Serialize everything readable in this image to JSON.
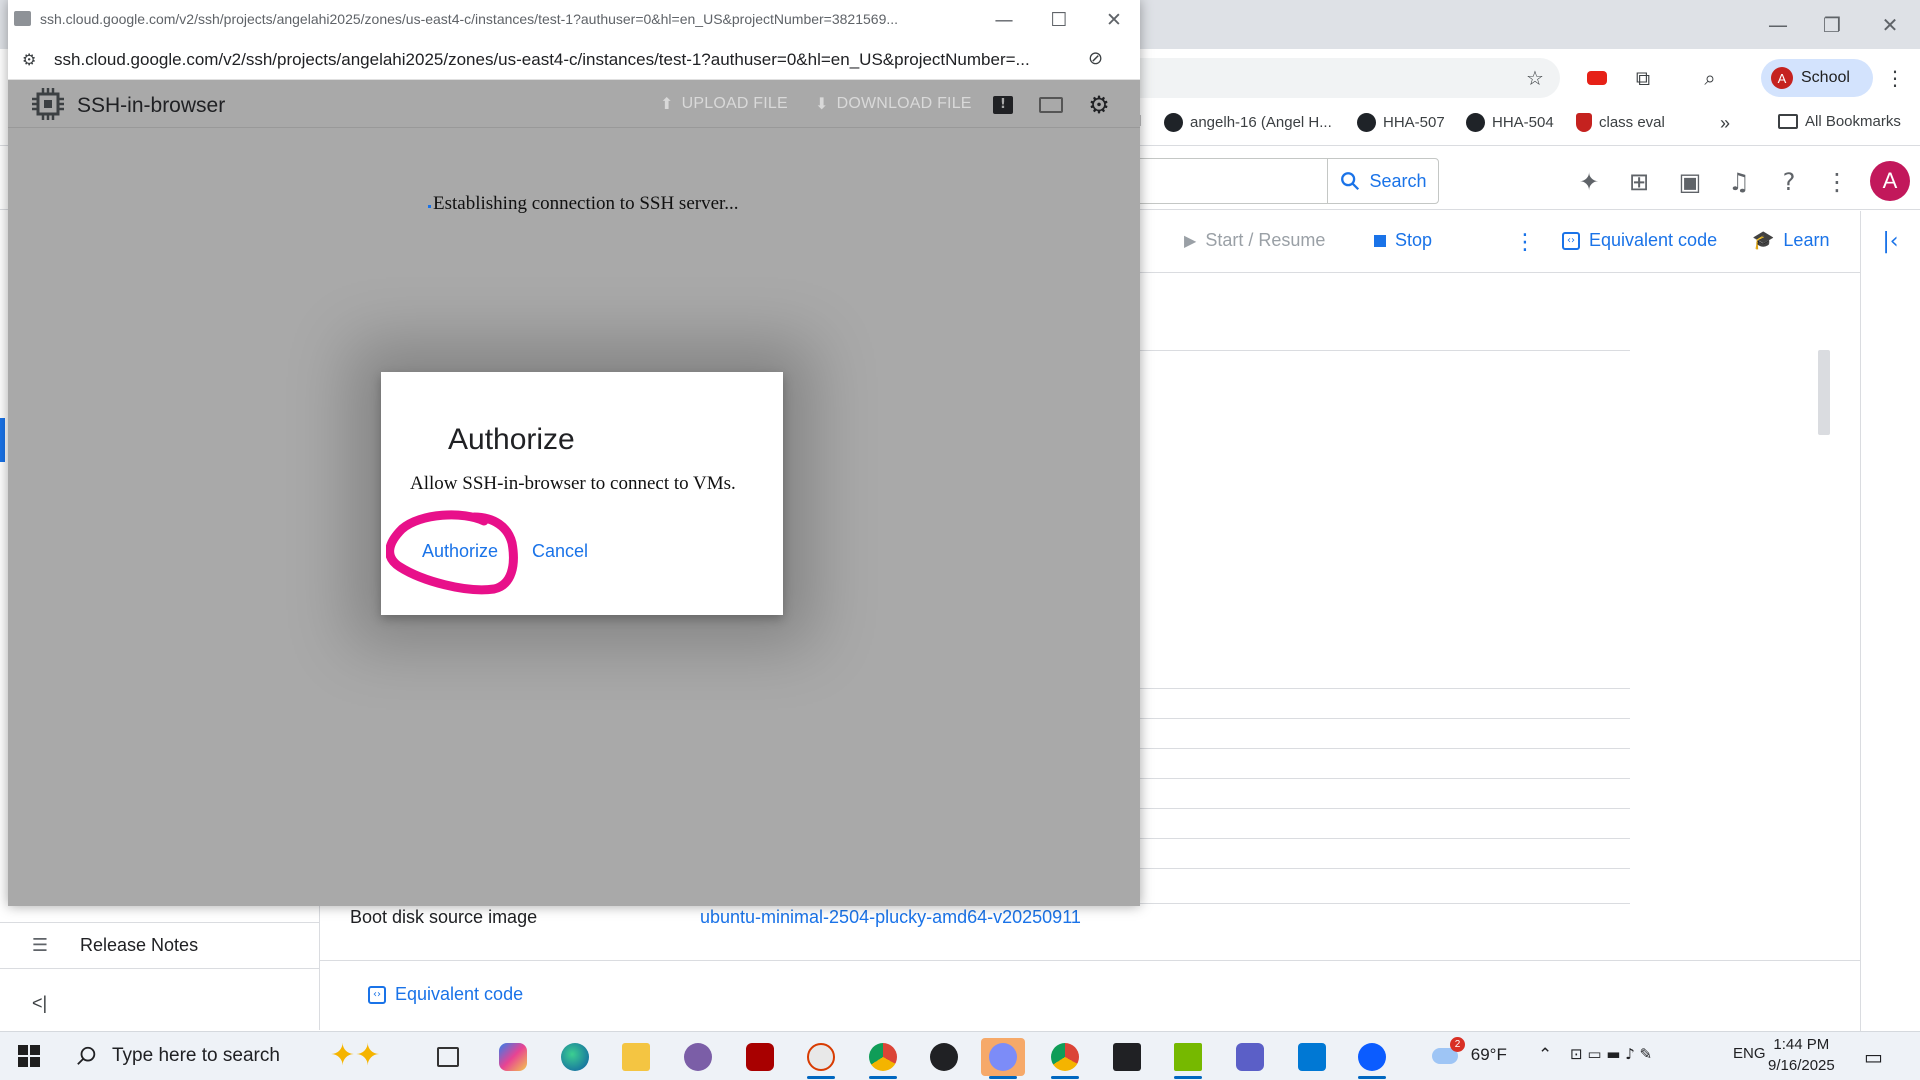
{
  "background": {
    "bookmarks": [
      "l",
      "angelh-16 (Angel H...",
      "HHA-507",
      "HHA-504",
      "class eval",
      "»",
      "All Bookmarks"
    ],
    "profile_chip": "School",
    "profile_initial": "A",
    "search_label": "Search",
    "avatar_initial": "A",
    "actions": {
      "start_resume": "Start / Resume",
      "stop": "Stop",
      "equivalent_code": "Equivalent code",
      "learn": "Learn"
    },
    "left_nav": {
      "release_notes": "Release Notes",
      "collapse": "<|"
    },
    "boot_disk_label": "Boot disk source image",
    "boot_disk_value": "ubuntu-minimal-2504-plucky-amd64-v20250911",
    "equivalent_code_bottom": "Equivalent code"
  },
  "popup": {
    "title": "ssh.cloud.google.com/v2/ssh/projects/angelahi2025/zones/us-east4-c/instances/test-1?authuser=0&hl=en_US&projectNumber=3821569...",
    "url": "ssh.cloud.google.com/v2/ssh/projects/angelahi2025/zones/us-east4-c/instances/test-1?authuser=0&hl=en_US&projectNumber=...",
    "app_title": "SSH-in-browser",
    "upload_file": "UPLOAD FILE",
    "download_file": "DOWNLOAD FILE",
    "status": "Establishing connection to SSH server..."
  },
  "dialog": {
    "title": "Authorize",
    "message": "Allow SSH-in-browser to connect to VMs.",
    "authorize": "Authorize",
    "cancel": "Cancel",
    "highlight_color": "#e8108a"
  },
  "taskbar": {
    "search_placeholder": "Type here to search",
    "weather_temp": "69°F",
    "badge": "2",
    "language": "ENG",
    "time": "1:44 PM",
    "date": "9/16/2025"
  }
}
